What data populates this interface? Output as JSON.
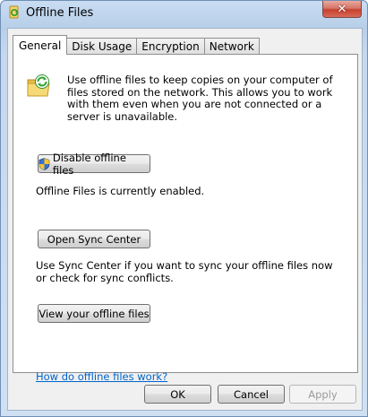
{
  "window": {
    "title": "Offline Files",
    "close_glyph": "✕"
  },
  "tabs": [
    {
      "label": "General",
      "active": true
    },
    {
      "label": "Disk Usage",
      "active": false
    },
    {
      "label": "Encryption",
      "active": false
    },
    {
      "label": "Network",
      "active": false
    }
  ],
  "general": {
    "intro_text": "Use offline files to keep copies on your computer of files stored on the network.  This allows you to work with them even when you are not connected or a server is unavailable.",
    "disable_button": "Disable offline files",
    "status_text": "Offline Files is currently enabled.",
    "sync_center_button": "Open Sync Center",
    "sync_center_text": "Use Sync Center if you want to sync your offline files now or check for sync conflicts.",
    "view_button": "View your offline files",
    "help_link": "How do offline files work?"
  },
  "footer": {
    "ok": "OK",
    "cancel": "Cancel",
    "apply": "Apply"
  },
  "icons": {
    "title": "offline-files-icon",
    "folder": "sync-folder-icon",
    "shield": "uac-shield-icon"
  }
}
